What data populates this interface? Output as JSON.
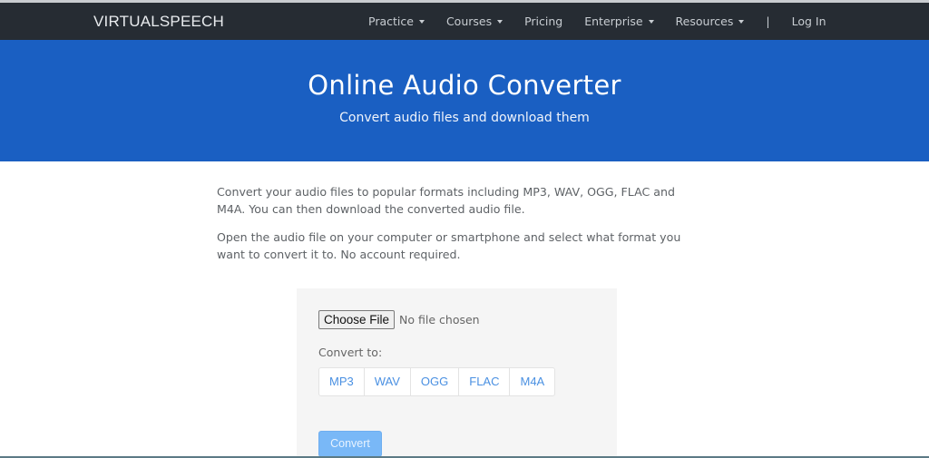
{
  "navbar": {
    "brand": "VIRTUALSPEECH",
    "items": [
      {
        "label": "Practice",
        "dropdown": true
      },
      {
        "label": "Courses",
        "dropdown": true
      },
      {
        "label": "Pricing",
        "dropdown": false
      },
      {
        "label": "Enterprise",
        "dropdown": true
      },
      {
        "label": "Resources",
        "dropdown": true
      }
    ],
    "separator": "|",
    "login": "Log In"
  },
  "hero": {
    "title": "Online Audio Converter",
    "subtitle": "Convert audio files and download them"
  },
  "content": {
    "paragraphs": [
      "Convert your audio files to popular formats including MP3, WAV, OGG, FLAC and M4A. You can then download the converted audio file.",
      "Open the audio file on your computer or smartphone and select what format you want to convert it to. No account required."
    ]
  },
  "converter": {
    "choose_file_label": "Choose File",
    "file_status": "No file chosen",
    "convert_to_label": "Convert to:",
    "formats": [
      "MP3",
      "WAV",
      "OGG",
      "FLAC",
      "M4A"
    ],
    "convert_button": "Convert",
    "convert_disabled": true
  },
  "colors": {
    "navbar_bg": "#262c33",
    "hero_bg": "#1a5fc2",
    "panel_bg": "#f5f5f5",
    "format_link": "#4a90e2",
    "convert_button_bg": "#79b8f7"
  }
}
